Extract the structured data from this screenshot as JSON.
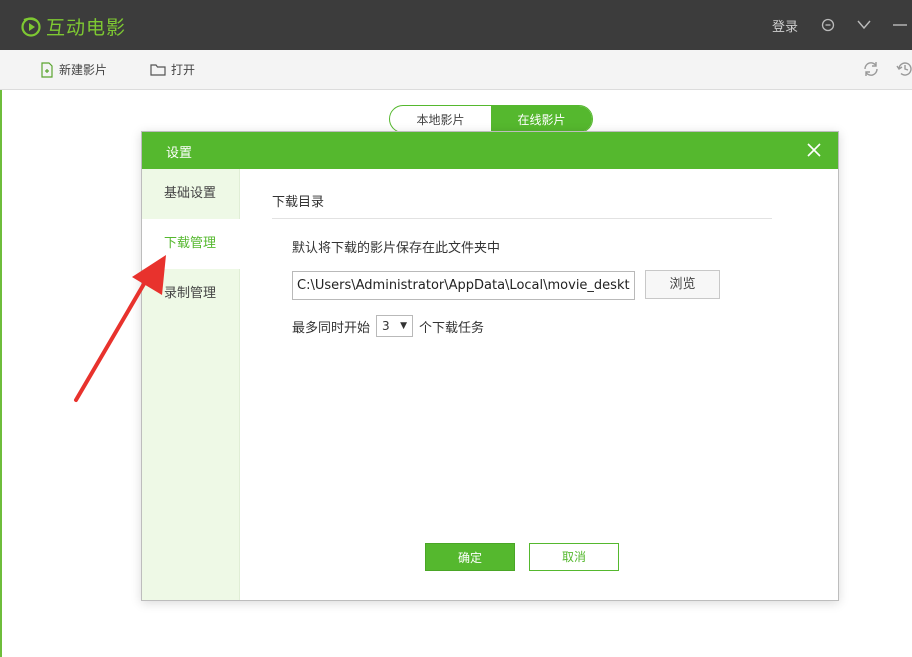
{
  "app": {
    "title": "互动电影",
    "login_label": "登录"
  },
  "toolbar": {
    "new_label": "新建影片",
    "open_label": "打开"
  },
  "mode_tabs": [
    {
      "label": "本地影片",
      "active": false
    },
    {
      "label": "在线影片",
      "active": true
    }
  ],
  "dialog": {
    "title": "设置",
    "sidebar": [
      {
        "label": "基础设置",
        "active": false
      },
      {
        "label": "下载管理",
        "active": true
      },
      {
        "label": "录制管理",
        "active": false
      }
    ],
    "section_title": "下载目录",
    "description": "默认将下载的影片保存在此文件夹中",
    "path_value": "C:\\Users\\Administrator\\AppData\\Local\\movie_desktop",
    "browse_label": "浏览",
    "max_prefix": "最多同时开始",
    "max_value": "3",
    "max_suffix": "个下载任务",
    "ok_label": "确定",
    "cancel_label": "取消"
  },
  "colors": {
    "accent": "#55b82e",
    "titlebar": "#3c3c3c",
    "annotation": "#e8322d"
  },
  "icons": [
    "logo-icon",
    "feedback-icon",
    "dropdown-icon",
    "new-file-icon",
    "folder-icon",
    "refresh-icon",
    "history-icon",
    "close-icon",
    "annotation-arrow"
  ]
}
